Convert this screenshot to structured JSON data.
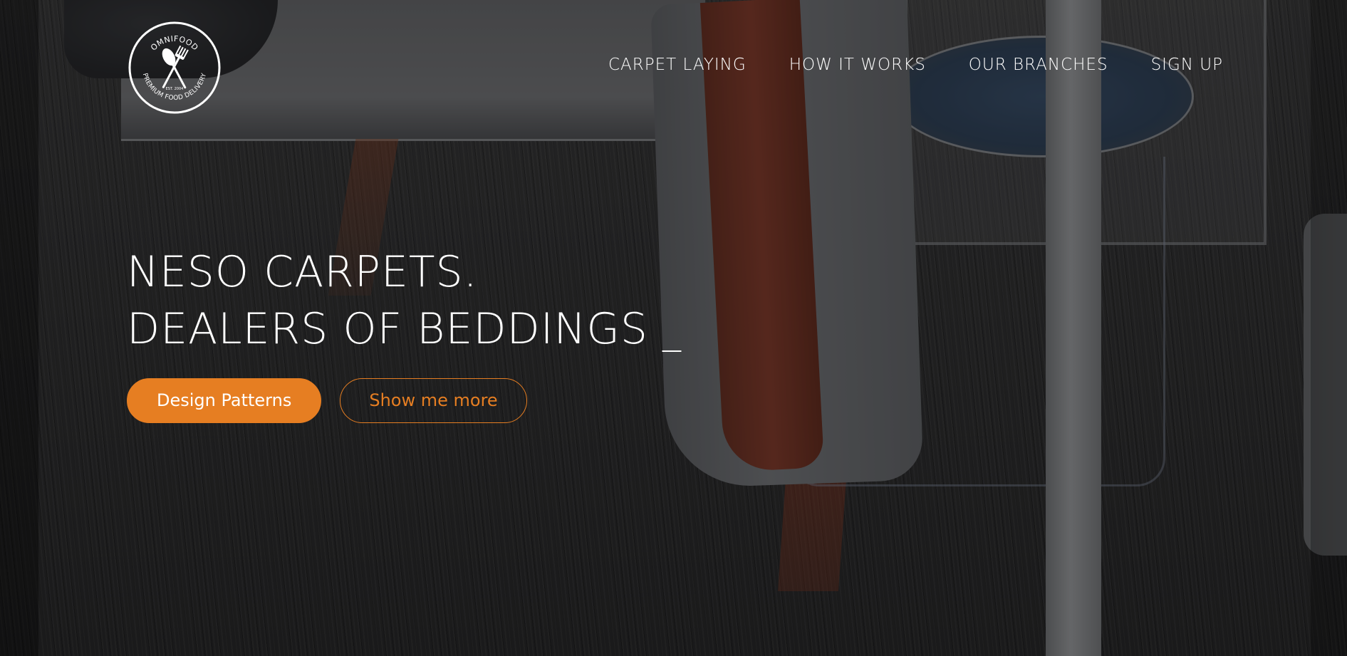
{
  "brand": {
    "logo_top_text": "OMNIFOOD",
    "logo_bottom_text": "PREMIUM FOOD DELIVERY",
    "logo_est_text": "EST. 2004"
  },
  "nav": {
    "items": [
      {
        "label": "CARPET LAYING"
      },
      {
        "label": "HOW IT WORKS"
      },
      {
        "label": "OUR BRANCHES"
      },
      {
        "label": "SIGN UP"
      }
    ]
  },
  "hero": {
    "headline_line1": "NESO CARPETS.",
    "headline_line2": "DEALERS OF BEDDINGS",
    "cursor": "_",
    "primary_button": "Design Patterns",
    "secondary_button": "Show me more"
  },
  "colors": {
    "accent": "#e67e22",
    "text": "#ffffff"
  }
}
